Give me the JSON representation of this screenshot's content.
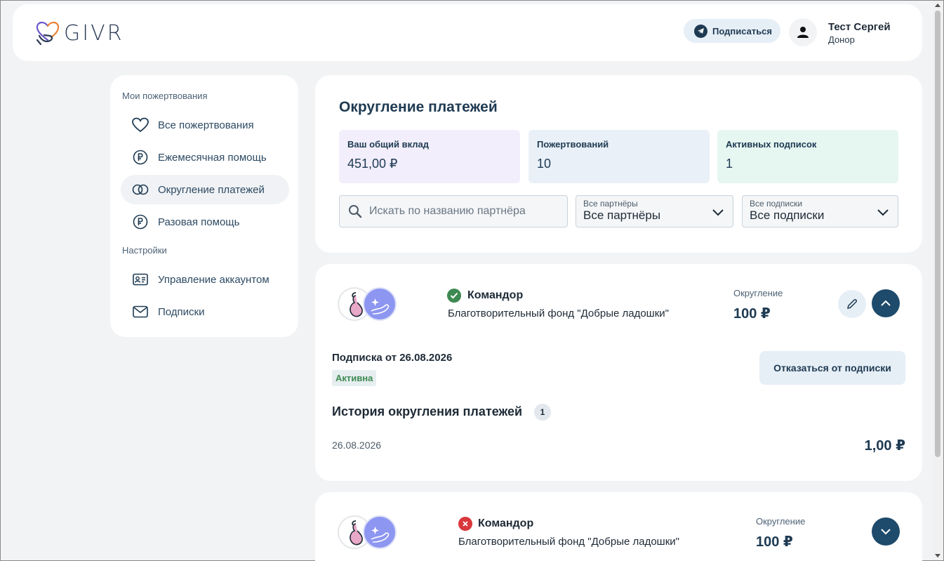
{
  "header": {
    "logo_text": "GIVR",
    "subscribe_label": "Подписаться",
    "user_name": "Тест Сергей",
    "user_role": "Донор"
  },
  "sidebar": {
    "section_donations": "Мои пожертвования",
    "section_settings": "Настройки",
    "items": [
      {
        "label": "Все пожертвования",
        "icon": "heart-icon"
      },
      {
        "label": "Ежемесячная помощь",
        "icon": "ruble-icon"
      },
      {
        "label": "Округление платежей",
        "icon": "rings-icon",
        "active": true
      },
      {
        "label": "Разовая помощь",
        "icon": "ruble-icon"
      },
      {
        "label": "Управление аккаунтом",
        "icon": "id-card-icon"
      },
      {
        "label": "Подписки",
        "icon": "mail-icon"
      }
    ]
  },
  "main": {
    "title": "Округление платежей",
    "stats": [
      {
        "label": "Ваш общий вклад",
        "value": "451,00 ₽",
        "color": "#f2eefb"
      },
      {
        "label": "Пожертвований",
        "value": "10",
        "color": "#e9f0f7"
      },
      {
        "label": "Активных подписок",
        "value": "1",
        "color": "#e6f6f1"
      }
    ],
    "search_placeholder": "Искать по названию партнёра",
    "filter_partners": {
      "label": "Все партнёры",
      "value": "Все партнёры"
    },
    "filter_subscriptions": {
      "label": "Все подписки",
      "value": "Все подписки"
    }
  },
  "cards": [
    {
      "partner": "Командор",
      "fund": "Благотворительный фонд \"Добрые ладошки\"",
      "amount_label": "Округление",
      "amount": "100 ₽",
      "status": "active",
      "subscription_from": "Подписка от 26.08.2026",
      "badge": "Активна",
      "cancel_label": "Отказаться от подписки",
      "history_title": "История округления платежей",
      "history_count": "1",
      "history": [
        {
          "date": "26.08.2026",
          "amount": "1,00 ₽"
        }
      ]
    },
    {
      "partner": "Командор",
      "fund": "Благотворительный фонд \"Добрые ладошки\"",
      "amount_label": "Округление",
      "amount": "100 ₽",
      "status": "cancelled"
    }
  ],
  "colors": {
    "accent_dark": "#1e4a6b",
    "status_ok": "#3d8a52",
    "status_err": "#d9383c"
  }
}
